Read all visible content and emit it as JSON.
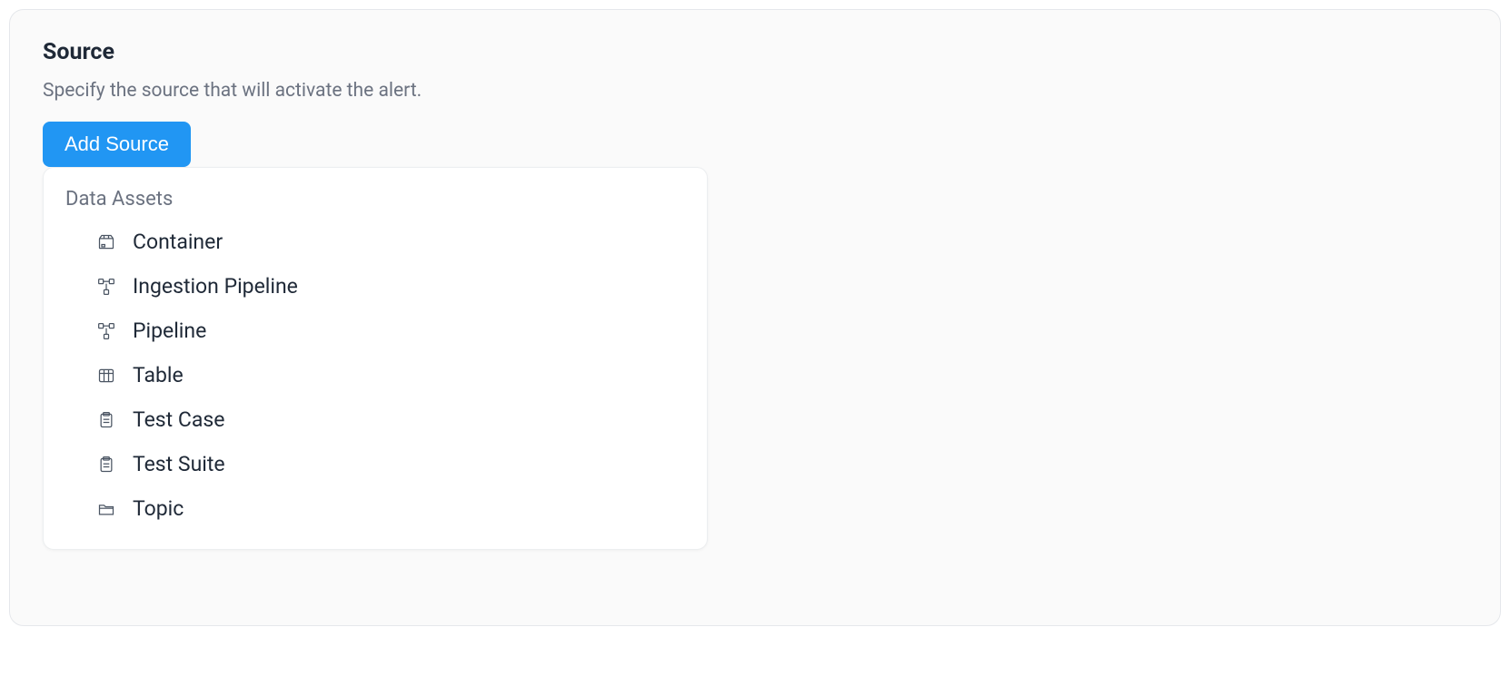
{
  "card": {
    "title": "Source",
    "subtitle": "Specify the source that will activate the alert.",
    "button_label": "Add Source"
  },
  "dropdown": {
    "group_label": "Data Assets",
    "items": [
      {
        "label": "Container",
        "icon": "container-icon"
      },
      {
        "label": "Ingestion Pipeline",
        "icon": "pipeline-icon"
      },
      {
        "label": "Pipeline",
        "icon": "pipeline-icon"
      },
      {
        "label": "Table",
        "icon": "table-icon"
      },
      {
        "label": "Test Case",
        "icon": "clipboard-icon"
      },
      {
        "label": "Test Suite",
        "icon": "clipboard-icon"
      },
      {
        "label": "Topic",
        "icon": "folder-icon"
      }
    ]
  }
}
